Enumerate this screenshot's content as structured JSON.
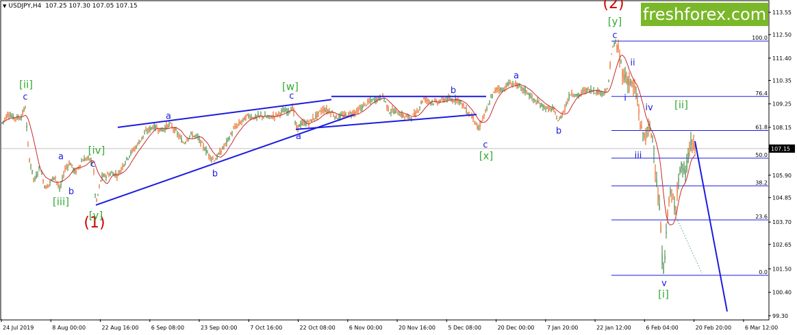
{
  "header": {
    "symbol": "USDJPY,H4",
    "ohlc": "107.25 107.30 107.05 107.15"
  },
  "brand": {
    "text": "freshforex.com",
    "color": "#7ab829"
  },
  "colors": {
    "candle": "#2e7d32",
    "candle_down": "#e65100",
    "ma": "#c62828",
    "trendline": "#1a1adf",
    "wave_blue": "#1a1adf",
    "wave_green": "#33aa33",
    "wave_red": "#d40000",
    "price_line": "#c0c0c0"
  },
  "chart_data": {
    "type": "candlestick",
    "symbol": "USDJPY",
    "timeframe": "H4",
    "ylim": [
      99.2,
      114.0
    ],
    "y_ticks": [
      "113.55",
      "112.50",
      "111.40",
      "110.35",
      "109.25",
      "108.15",
      "107.15",
      "105.90",
      "104.85",
      "103.70",
      "102.65",
      "101.50",
      "100.40",
      "99.30"
    ],
    "x_ticks": [
      "24 Jul 2019",
      "8 Aug 00:00",
      "22 Aug 16:00",
      "6 Sep 08:00",
      "23 Sep 00:00",
      "7 Oct 16:00",
      "22 Oct 08:00",
      "6 Nov 00:00",
      "20 Nov 16:00",
      "5 Dec 08:00",
      "20 Dec 00:00",
      "7 Jan 20:00",
      "22 Jan 12:00",
      "6 Feb 04:00",
      "20 Feb 20:00",
      "6 Mar 12:00"
    ],
    "current_price": "107.15",
    "price_path": [
      [
        0,
        108.2
      ],
      [
        12,
        108.8
      ],
      [
        20,
        108.6
      ],
      [
        30,
        108.6
      ],
      [
        37,
        109.1
      ],
      [
        42,
        106.8
      ],
      [
        50,
        105.6
      ],
      [
        58,
        106.3
      ],
      [
        66,
        105.3
      ],
      [
        72,
        105.5
      ],
      [
        80,
        105.9
      ],
      [
        87,
        105.2
      ],
      [
        95,
        106.2
      ],
      [
        102,
        106.5
      ],
      [
        110,
        106.0
      ],
      [
        120,
        106.6
      ],
      [
        128,
        106.7
      ],
      [
        136,
        106.5
      ],
      [
        140,
        104.5
      ],
      [
        148,
        105.8
      ],
      [
        156,
        105.9
      ],
      [
        164,
        106.0
      ],
      [
        172,
        105.9
      ],
      [
        180,
        106.4
      ],
      [
        190,
        106.9
      ],
      [
        200,
        107.3
      ],
      [
        212,
        107.9
      ],
      [
        224,
        108.2
      ],
      [
        236,
        108.0
      ],
      [
        248,
        108.3
      ],
      [
        258,
        107.9
      ],
      [
        268,
        107.4
      ],
      [
        278,
        107.8
      ],
      [
        288,
        107.7
      ],
      [
        298,
        107.2
      ],
      [
        306,
        106.8
      ],
      [
        314,
        106.6
      ],
      [
        322,
        107.0
      ],
      [
        332,
        107.5
      ],
      [
        342,
        108.1
      ],
      [
        352,
        108.4
      ],
      [
        362,
        108.7
      ],
      [
        372,
        108.6
      ],
      [
        382,
        108.7
      ],
      [
        392,
        108.6
      ],
      [
        402,
        108.7
      ],
      [
        412,
        108.9
      ],
      [
        420,
        108.9
      ],
      [
        428,
        109.1
      ],
      [
        432,
        108.1
      ],
      [
        440,
        108.3
      ],
      [
        452,
        108.4
      ],
      [
        462,
        108.7
      ],
      [
        472,
        109.0
      ],
      [
        482,
        108.9
      ],
      [
        492,
        108.6
      ],
      [
        502,
        108.7
      ],
      [
        512,
        108.8
      ],
      [
        522,
        108.9
      ],
      [
        532,
        109.2
      ],
      [
        542,
        109.4
      ],
      [
        552,
        109.5
      ],
      [
        560,
        109.6
      ],
      [
        568,
        108.9
      ],
      [
        578,
        108.9
      ],
      [
        588,
        108.7
      ],
      [
        598,
        108.6
      ],
      [
        608,
        108.8
      ],
      [
        618,
        109.5
      ],
      [
        626,
        109.4
      ],
      [
        636,
        109.3
      ],
      [
        644,
        109.4
      ],
      [
        652,
        109.5
      ],
      [
        660,
        109.4
      ],
      [
        668,
        109.5
      ],
      [
        676,
        109.2
      ],
      [
        684,
        108.8
      ],
      [
        692,
        108.6
      ],
      [
        698,
        108.0
      ],
      [
        704,
        108.5
      ],
      [
        710,
        108.9
      ],
      [
        718,
        109.6
      ],
      [
        726,
        110.0
      ],
      [
        734,
        109.9
      ],
      [
        742,
        110.2
      ],
      [
        752,
        110.2
      ],
      [
        760,
        110.0
      ],
      [
        770,
        109.8
      ],
      [
        780,
        109.4
      ],
      [
        790,
        109.2
      ],
      [
        800,
        109.0
      ],
      [
        808,
        109.0
      ],
      [
        816,
        108.4
      ],
      [
        824,
        109.0
      ],
      [
        834,
        109.8
      ],
      [
        844,
        109.6
      ],
      [
        854,
        109.9
      ],
      [
        864,
        109.9
      ],
      [
        874,
        109.8
      ],
      [
        882,
        109.8
      ],
      [
        888,
        109.9
      ],
      [
        892,
        111.5
      ],
      [
        898,
        112.2
      ],
      [
        904,
        111.6
      ],
      [
        910,
        110.6
      ],
      [
        916,
        110.4
      ],
      [
        922,
        110.2
      ],
      [
        928,
        109.8
      ],
      [
        932,
        109.2
      ],
      [
        936,
        108.0
      ],
      [
        942,
        107.7
      ],
      [
        948,
        108.1
      ],
      [
        954,
        107.6
      ],
      [
        958,
        105.8
      ],
      [
        964,
        104.0
      ],
      [
        968,
        101.3
      ],
      [
        972,
        102.4
      ],
      [
        976,
        104.8
      ],
      [
        980,
        105.0
      ],
      [
        986,
        104.3
      ],
      [
        990,
        105.6
      ],
      [
        996,
        106.4
      ],
      [
        1000,
        105.8
      ],
      [
        1004,
        106.5
      ],
      [
        1008,
        107.5
      ],
      [
        1012,
        107.2
      ],
      [
        1015,
        107.15
      ]
    ],
    "trendlines": [
      {
        "from": [
          140,
          104.5
        ],
        "to": [
          518,
          108.75
        ]
      },
      {
        "from": [
          172,
          108.15
        ],
        "to": [
          484,
          109.45
        ]
      },
      {
        "from": [
          432,
          108.05
        ],
        "to": [
          696,
          108.75
        ]
      },
      {
        "from": [
          484,
          109.6
        ],
        "to": [
          710,
          109.6
        ]
      },
      {
        "from": [
          1015,
          107.5
        ],
        "to": [
          1062,
          99.5
        ]
      }
    ],
    "fibonacci": [
      {
        "label": "100.0",
        "price": 112.2
      },
      {
        "label": "76.4",
        "price": 109.6
      },
      {
        "label": "61.8",
        "price": 108.0
      },
      {
        "label": "50.0",
        "price": 106.7
      },
      {
        "label": "38.2",
        "price": 105.4
      },
      {
        "label": "23.6",
        "price": 103.8
      },
      {
        "label": "0.0",
        "price": 101.2
      }
    ],
    "wave_labels": [
      {
        "text": "(2)",
        "color": "red",
        "x": 896,
        "price": 113.75
      },
      {
        "text": "(1)",
        "color": "red",
        "x": 138,
        "price": 103.45
      },
      {
        "text": "[y]",
        "color": "green",
        "x": 898,
        "price": 112.95
      },
      {
        "text": "c",
        "color": "blue",
        "x": 898,
        "price": 112.35
      },
      {
        "text": "[ii]",
        "color": "green",
        "x": 38,
        "price": 110.0
      },
      {
        "text": "c",
        "color": "blue",
        "x": 37,
        "price": 109.45
      },
      {
        "text": "a",
        "color": "blue",
        "x": 89,
        "price": 106.65
      },
      {
        "text": "b",
        "color": "blue",
        "x": 104,
        "price": 105.0
      },
      {
        "text": "[iii]",
        "color": "green",
        "x": 89,
        "price": 104.5
      },
      {
        "text": "[iv]",
        "color": "green",
        "x": 141,
        "price": 106.9
      },
      {
        "text": "c",
        "color": "blue",
        "x": 136,
        "price": 106.3
      },
      {
        "text": "[y]",
        "color": "green",
        "x": 140,
        "price": 103.85
      },
      {
        "text": "a",
        "color": "blue",
        "x": 246,
        "price": 108.55
      },
      {
        "text": "b",
        "color": "blue",
        "x": 314,
        "price": 105.85
      },
      {
        "text": "[w]",
        "color": "green",
        "x": 424,
        "price": 109.9
      },
      {
        "text": "c",
        "color": "blue",
        "x": 426,
        "price": 109.5
      },
      {
        "text": "a",
        "color": "blue",
        "x": 436,
        "price": 107.6
      },
      {
        "text": "b",
        "color": "blue",
        "x": 662,
        "price": 109.75
      },
      {
        "text": "c",
        "color": "blue",
        "x": 709,
        "price": 107.2
      },
      {
        "text": "[x]",
        "color": "green",
        "x": 710,
        "price": 106.65
      },
      {
        "text": "a",
        "color": "blue",
        "x": 754,
        "price": 110.45
      },
      {
        "text": "b",
        "color": "blue",
        "x": 816,
        "price": 107.85
      },
      {
        "text": "ii",
        "color": "blue",
        "x": 924,
        "price": 111.05
      },
      {
        "text": "i",
        "color": "blue",
        "x": 913,
        "price": 109.4
      },
      {
        "text": "iv",
        "color": "blue",
        "x": 948,
        "price": 108.95
      },
      {
        "text": "[ii]",
        "color": "green",
        "x": 995,
        "price": 109.05
      },
      {
        "text": "iii",
        "color": "blue",
        "x": 932,
        "price": 106.7
      },
      {
        "text": "v",
        "color": "blue",
        "x": 970,
        "price": 100.7
      },
      {
        "text": "[i]",
        "color": "green",
        "x": 969,
        "price": 100.15
      }
    ]
  }
}
